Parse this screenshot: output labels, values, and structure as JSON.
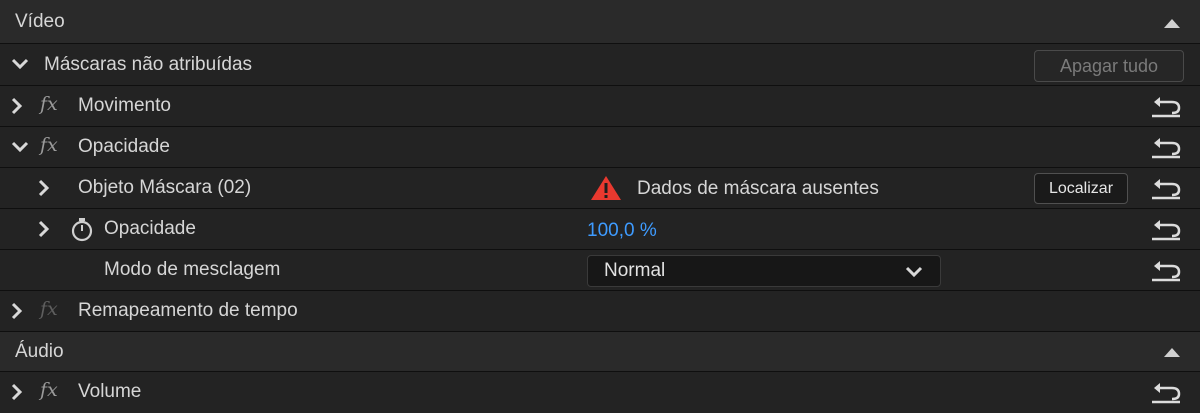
{
  "video": {
    "header": "Vídeo",
    "unassigned_masks": {
      "label": "Máscaras não atribuídas",
      "clear_all_label": "Apagar tudo"
    },
    "effects": {
      "motion": "Movimento",
      "opacity": {
        "label": "Opacidade",
        "mask_object_label": "Objeto Máscara (02)",
        "warning_text": "Dados de máscara ausentes",
        "locate_label": "Localizar",
        "opacity_param_label": "Opacidade",
        "opacity_value": "100,0 %",
        "blend_mode_label": "Modo de mesclagem",
        "blend_mode_value": "Normal"
      },
      "time_remap": "Remapeamento de tempo"
    }
  },
  "audio": {
    "header": "Áudio",
    "volume": "Volume"
  },
  "fx_glyph": "fx",
  "colors": {
    "value_blue": "#3e9bff",
    "warning_red": "#e8392f"
  }
}
